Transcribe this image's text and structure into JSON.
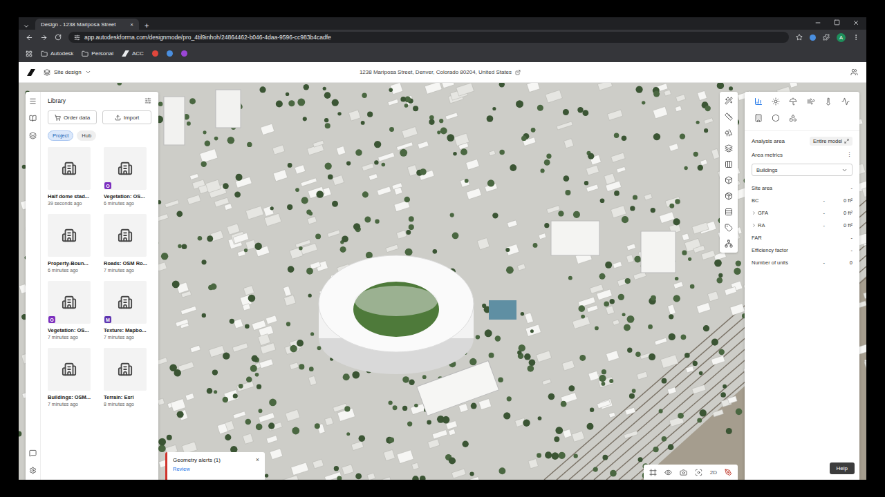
{
  "browser": {
    "tabs": [
      {
        "title": "Design - 1238 Mariposa Street",
        "close": "×",
        "selected": true
      }
    ],
    "new_tab": "+",
    "url": "app.autodeskforma.com/designmode/pro_4til9inhoh/24864462-b046-4daa-9596-cc983b4cadfe",
    "profile": "A",
    "bookmarks": [
      {
        "label": "Autodesk",
        "kind": "folder"
      },
      {
        "label": "Personal",
        "kind": "folder"
      },
      {
        "label": "ACC",
        "kind": "link"
      }
    ]
  },
  "app": {
    "mode": "Site design",
    "address": "1238 Mariposa Street, Denver, Colorado 80204, United States"
  },
  "library": {
    "title": "Library",
    "buttons": [
      "Order data",
      "Import"
    ],
    "filters": [
      {
        "label": "Project",
        "selected": true
      },
      {
        "label": "Hub",
        "selected": false
      }
    ],
    "items": [
      {
        "name": "Half dome stad...",
        "time": "39 seconds ago",
        "badge": "",
        "color": "#7b2fbe"
      },
      {
        "name": "Vegetation: OS...",
        "time": "6 minutes ago",
        "badge": "O",
        "color": "#7b2fbe"
      },
      {
        "name": "Property-Boun...",
        "time": "6 minutes ago",
        "badge": "",
        "color": "#2e7d32"
      },
      {
        "name": "Roads: OSM Ro...",
        "time": "7 minutes ago",
        "badge": "",
        "color": "#2e7d32"
      },
      {
        "name": "Vegetation: OS...",
        "time": "7 minutes ago",
        "badge": "O",
        "color": "#7b2fbe"
      },
      {
        "name": "Texture: Mapbo...",
        "time": "7 minutes ago",
        "badge": "M",
        "color": "#5e35b1"
      },
      {
        "name": "Buildings: OSM...",
        "time": "7 minutes ago",
        "badge": "",
        "color": "#2e7d32"
      },
      {
        "name": "Terrain: Esri",
        "time": "8 minutes ago",
        "badge": "",
        "color": "#333333"
      }
    ]
  },
  "geometry_alert": {
    "title": "Geometry alerts (1)",
    "action": "Review",
    "close": "×"
  },
  "view_toolbar": {
    "mode_label": "2D"
  },
  "analysis": {
    "tools": [
      {
        "selected": true
      },
      {
        "selected": false
      },
      {
        "selected": false
      },
      {
        "selected": false
      },
      {
        "selected": false
      },
      {
        "selected": false
      },
      {
        "selected": false
      },
      {
        "selected": false
      },
      {
        "selected": false
      }
    ],
    "area_label": "Analysis area",
    "area_value": "Entire model",
    "metrics_title": "Area metrics",
    "metrics_menu": "⋮",
    "filter": "Buildings",
    "rows": [
      {
        "label": "Site area",
        "mid": "",
        "value": "-",
        "expandable": false
      },
      {
        "label": "BC",
        "mid": "-",
        "value": "0 ft²",
        "expandable": false
      },
      {
        "label": "GFA",
        "mid": "-",
        "value": "0 ft²",
        "expandable": true
      },
      {
        "label": "RA",
        "mid": "-",
        "value": "0 ft²",
        "expandable": true
      },
      {
        "label": "FAR",
        "mid": "",
        "value": "-",
        "expandable": false
      },
      {
        "label": "Efficiency factor",
        "mid": "",
        "value": "-",
        "expandable": false
      },
      {
        "label": "Number of units",
        "mid": "-",
        "value": "0",
        "expandable": false
      }
    ]
  },
  "help": "Help"
}
